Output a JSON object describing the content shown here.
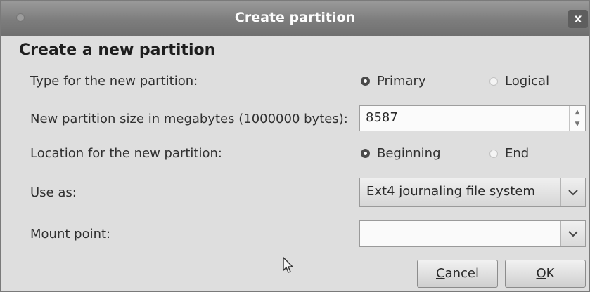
{
  "window": {
    "title": "Create partition",
    "close_label": "x"
  },
  "header": "Create a new partition",
  "type": {
    "label": "Type for the new partition:",
    "options": [
      {
        "label": "Primary",
        "selected": true
      },
      {
        "label": "Logical",
        "selected": false
      }
    ]
  },
  "size": {
    "label": "New partition size in megabytes (1000000 bytes):",
    "value": "8587"
  },
  "location": {
    "label": "Location for the new partition:",
    "options": [
      {
        "label": "Beginning",
        "selected": true
      },
      {
        "label": "End",
        "selected": false
      }
    ]
  },
  "use_as": {
    "label": "Use as:",
    "value": "Ext4 journaling file system"
  },
  "mount_point": {
    "label": "Mount point:",
    "value": ""
  },
  "buttons": {
    "cancel": {
      "mnemonic": "C",
      "rest": "ancel"
    },
    "ok": {
      "mnemonic": "O",
      "rest": "K"
    }
  },
  "icons": {
    "close": "close-icon",
    "dropdown": "chevron-down-icon",
    "spin_up": "chevron-up-icon",
    "spin_down": "chevron-down-icon",
    "cursor": "mouse-pointer-icon"
  }
}
